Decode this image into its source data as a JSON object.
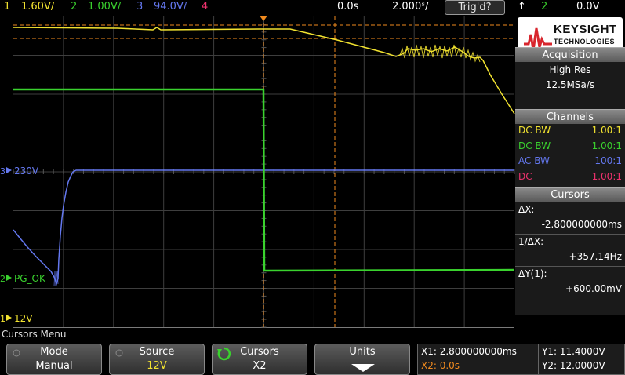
{
  "top_bar": {
    "ch1_num": "1",
    "ch1_scale": "1.60V/",
    "ch2_num": "2",
    "ch2_scale": "1.00V/",
    "ch3_num": "3",
    "ch3_scale": "94.0V/",
    "ch4_num": "4",
    "time_offset": "0.0s",
    "timebase": "2.000s/",
    "timebase_display": "2.000ˢ/",
    "trigger_status": "Trig'd?",
    "trigger_slope": "↑",
    "trigger_source": "2",
    "trigger_level": "0.0V"
  },
  "waveform_labels": {
    "ch3_label": "230V",
    "ch3_num": "3",
    "ch2_label": "PG_OK",
    "ch2_num": "2",
    "ch1_label": "12V",
    "ch1_num": "1"
  },
  "brand": {
    "name": "KEYSIGHT",
    "sub": "TECHNOLOGIES"
  },
  "acquisition": {
    "title": "Acquisition",
    "mode": "High Res",
    "rate": "12.5MSa/s"
  },
  "channels": {
    "title": "Channels",
    "rows": [
      {
        "coupling": "DC BW",
        "ratio": "1.00:1",
        "color": "#f2e330"
      },
      {
        "coupling": "DC BW",
        "ratio": "1.00:1",
        "color": "#3ad22e"
      },
      {
        "coupling": "AC BW",
        "ratio": "100:1",
        "color": "#6478f0"
      },
      {
        "coupling": "DC",
        "ratio": "1.00:1",
        "color": "#f0326e"
      }
    ]
  },
  "cursors": {
    "title": "Cursors",
    "dx_label": "ΔX:",
    "dx_value": "-2.800000000ms",
    "inv_dx_label": "1/ΔX:",
    "inv_dx_value": "+357.14Hz",
    "dy_label": "ΔY(1):",
    "dy_value": "+600.00mV"
  },
  "menu": {
    "title": "Cursors Menu",
    "softkeys": [
      {
        "label": "Mode",
        "value": "Manual"
      },
      {
        "label": "Source",
        "value": "12V"
      },
      {
        "label": "Cursors",
        "value": "X2"
      },
      {
        "label": "Units",
        "value": ""
      }
    ]
  },
  "readout": {
    "x1": "X1: 2.800000000ms",
    "x2": "X2: 0.0s",
    "y1": "Y1: 11.4000V",
    "y2": "Y2: 12.0000V"
  },
  "colors": {
    "ch1": "#f2e330",
    "ch2": "#3ad22e",
    "ch3": "#6478f0",
    "ch4": "#f0326e",
    "cursor": "#f08a1e"
  }
}
